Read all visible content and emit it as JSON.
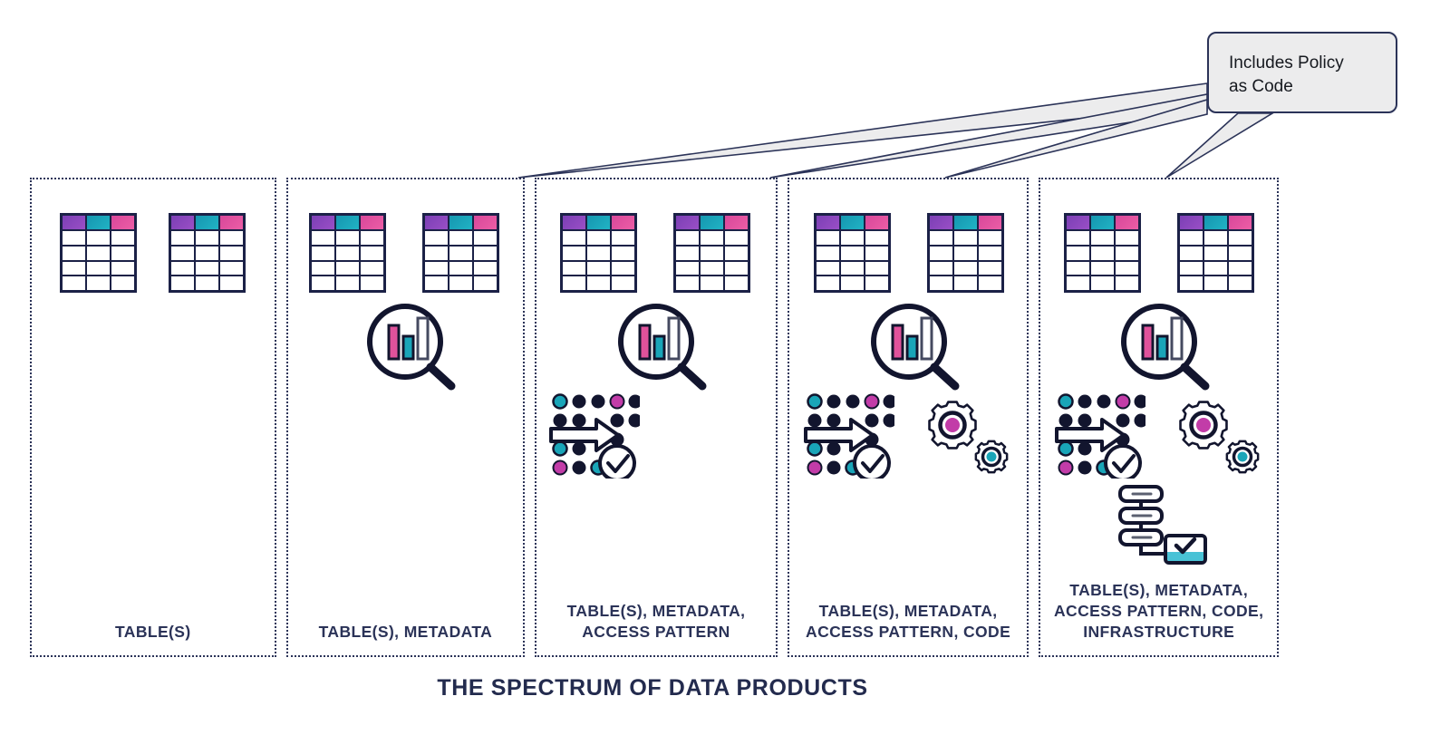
{
  "diagram": {
    "title": "THE SPECTRUM OF DATA PRODUCTS",
    "callout": {
      "text": "Includes Policy\nas Code",
      "fill": "#ececed",
      "border": "#2b3358"
    },
    "palette": {
      "navy": "#1b2147",
      "panel_border": "#2b3358",
      "purple": "#8B44BE",
      "teal": "#19A5B8",
      "pink": "#E0529B",
      "background": "#ffffff"
    },
    "panels": [
      {
        "id": "panel-tables",
        "label": "TABLE(S)",
        "icons": [
          "table-icon",
          "table-icon"
        ],
        "table_count": 2
      },
      {
        "id": "panel-tables-metadata",
        "label": "TABLE(S), METADATA",
        "icons": [
          "table-icon",
          "table-icon",
          "magnifier-chart-icon"
        ],
        "table_count": 2
      },
      {
        "id": "panel-tables-metadata-access",
        "label": "TABLE(S), METADATA,\nACCESS PATTERN",
        "icons": [
          "table-icon",
          "table-icon",
          "magnifier-chart-icon",
          "access-pattern-icon"
        ],
        "table_count": 2
      },
      {
        "id": "panel-tables-metadata-access-code",
        "label": "TABLE(S), METADATA,\nACCESS PATTERN,  CODE",
        "icons": [
          "table-icon",
          "table-icon",
          "magnifier-chart-icon",
          "access-pattern-icon",
          "gears-icon"
        ],
        "table_count": 2
      },
      {
        "id": "panel-tables-metadata-access-code-infra",
        "label": "TABLE(S), METADATA,\nACCESS PATTERN,  CODE,\nINFRASTRUCTURE",
        "icons": [
          "table-icon",
          "table-icon",
          "magnifier-chart-icon",
          "access-pattern-icon",
          "gears-icon",
          "infrastructure-icon"
        ],
        "table_count": 2
      }
    ],
    "table_icon": {
      "columns": 3,
      "body_rows": 4,
      "header_colors": [
        "#8B44BE",
        "#19A5B8",
        "#E0529B"
      ]
    },
    "magnifier_icon": {
      "bars": [
        {
          "color": "#E0529B",
          "height_rel": 0.62
        },
        {
          "color": "#19A5B8",
          "height_rel": 0.44
        },
        {
          "color": "#ffffff",
          "height_rel": 0.82
        }
      ]
    },
    "access_pattern_icon": {
      "dot_colors": [
        "#19A5B8",
        "#1b2147",
        "#E0529B"
      ],
      "arrow": "right-arrow",
      "check": "check-circle"
    },
    "gears_icon": {
      "large_center": "#C23CA8",
      "small_center": "#19A5B8"
    },
    "infrastructure_icon": {
      "servers": 3,
      "monitor_fill": "#49c2d6",
      "check": "check"
    },
    "callout_pointers": 4
  }
}
